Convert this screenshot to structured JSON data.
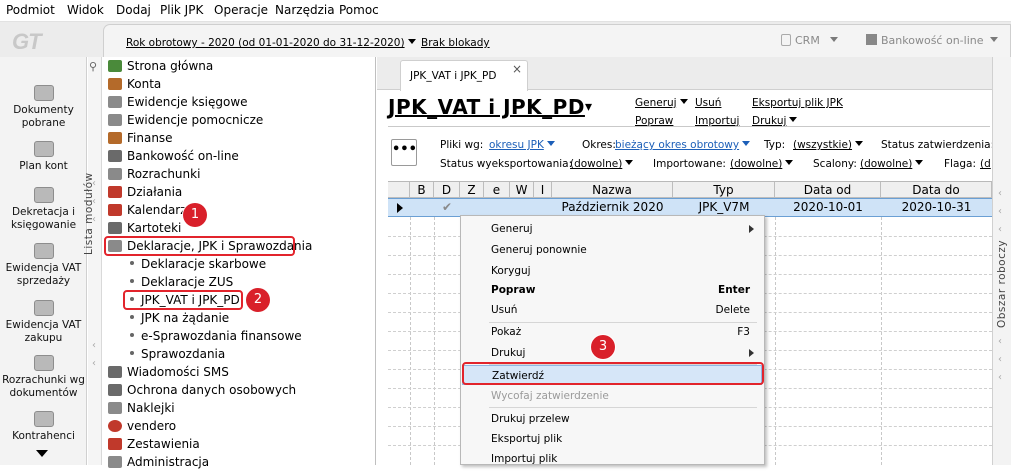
{
  "menubar": [
    "Podmiot",
    "Widok",
    "Dodaj",
    "Plik JPK",
    "Operacje",
    "Narzędzia",
    "Pomoc"
  ],
  "header": {
    "logo": "GT",
    "period": "Rok obrotowy - 2020  (od 01-01-2020 do 31-12-2020)",
    "lock": "Brak blokady",
    "crm": "CRM",
    "bank": "Bankowość on-line"
  },
  "leftbar": [
    "Dokumenty pobrane",
    "Plan kont",
    "Dekretacja i księgowanie",
    "Ewidencja VAT sprzedaży",
    "Ewidencja VAT zakupu",
    "Rozrachunki wg dokumentów",
    "Kontrahenci"
  ],
  "modules_label": "Lista modułów",
  "tree": [
    {
      "label": "Strona główna",
      "color": "#4a8a3a"
    },
    {
      "label": "Konta",
      "color": "#b46a2a"
    },
    {
      "label": "Ewidencje księgowe",
      "color": "#8a8a8a"
    },
    {
      "label": "Ewidencje pomocnicze",
      "color": "#8a8a8a"
    },
    {
      "label": "Finanse",
      "color": "#b46a2a"
    },
    {
      "label": "Bankowość on-line",
      "color": "#6a6a6a"
    },
    {
      "label": "Rozrachunki",
      "color": "#8a8a8a"
    },
    {
      "label": "Działania",
      "color": "#c0392b"
    },
    {
      "label": "Kalendarz",
      "color": "#c0392b"
    },
    {
      "label": "Kartoteki",
      "color": "#6a6a6a"
    },
    {
      "label": "Deklaracje, JPK i Sprawozdania",
      "color": "#8a8a8a"
    }
  ],
  "tree_sub": [
    "Deklaracje skarbowe",
    "Deklaracje ZUS",
    "JPK_VAT i JPK_PD",
    "JPK na żądanie",
    "e-Sprawozdania finansowe",
    "Sprawozdania"
  ],
  "tree_more": [
    {
      "label": "Wiadomości SMS",
      "color": "#6a6a6a"
    },
    {
      "label": "Ochrona danych osobowych",
      "color": "#6a6a6a"
    },
    {
      "label": "Naklejki",
      "color": "#8a8a8a"
    },
    {
      "label": "vendero",
      "color": "#c0392b"
    },
    {
      "label": "Zestawienia",
      "color": "#c0392b"
    },
    {
      "label": "Administracja",
      "color": "#8a8a8a"
    }
  ],
  "badges": [
    "1",
    "2",
    "3"
  ],
  "tab": {
    "label": "JPK_VAT i JPK_PD",
    "close": "×"
  },
  "page_title": "JPK_VAT i JPK_PD",
  "actions": [
    "Generuj",
    "Usuń",
    "Eksportuj plik JPK",
    "Popraw",
    "Importuj",
    "Drukuj"
  ],
  "filters": {
    "pliki_lbl": "Pliki wg:",
    "pliki_val": "okresu JPK",
    "okres_lbl": "Okres:",
    "okres_val": "bieżący okres obrotowy",
    "typ_lbl": "Typ:",
    "typ_val": "(wszystkie)",
    "status_zatw_lbl": "Status zatwierdzenia:",
    "status_wyek_lbl": "Status wyeksportowania:",
    "status_wyek_val": "(dowolne)",
    "imp_lbl": "Importowane:",
    "imp_val": "(dowolne)",
    "scal_lbl": "Scalony:",
    "scal_val": "(dowolne)",
    "flaga_lbl": "Flaga:",
    "flaga_val": "(d"
  },
  "columns": [
    "B",
    "D",
    "Z",
    "e",
    "W",
    "I",
    "Nazwa",
    "Typ",
    "Data od",
    "Data do"
  ],
  "row": {
    "nazwa": "Październik 2020",
    "typ": "JPK_V7M",
    "od": "2020-10-01",
    "do": "2020-10-31"
  },
  "context_menu": [
    {
      "label": "Generuj",
      "sc": "",
      "sub": true
    },
    {
      "label": "Generuj ponownie",
      "sc": ""
    },
    {
      "label": "Koryguj",
      "sc": ""
    },
    {
      "label": "Popraw",
      "sc": "Enter",
      "bold": true
    },
    {
      "label": "Usuń",
      "sc": "Delete"
    },
    {
      "label": "Pokaż",
      "sc": "F3"
    },
    {
      "label": "Drukuj",
      "sc": "",
      "sub": true
    },
    {
      "label": "Zatwierdź",
      "sc": ""
    },
    {
      "label": "Wycofaj zatwierdzenie",
      "sc": "",
      "disabled": true
    },
    {
      "label": "Drukuj przelew",
      "sc": ""
    },
    {
      "label": "Eksportuj plik",
      "sc": ""
    },
    {
      "label": "Importuj plik",
      "sc": ""
    }
  ],
  "right_label": "Obszar roboczy"
}
